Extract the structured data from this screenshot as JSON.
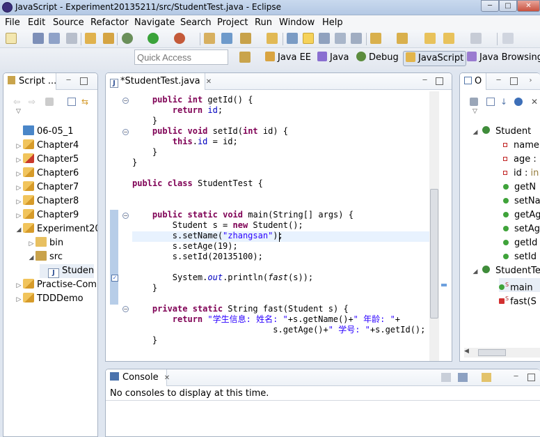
{
  "window": {
    "title": "JavaScript - Experiment20135211/src/StudentTest.java - Eclipse",
    "minimize": "─",
    "maximize": "□",
    "close": "✕"
  },
  "menu": [
    "File",
    "Edit",
    "Source",
    "Refactor",
    "Navigate",
    "Search",
    "Project",
    "Run",
    "Window",
    "Help"
  ],
  "quick_access": {
    "placeholder": "Quick Access"
  },
  "perspectives": [
    {
      "label": "Java EE",
      "icon": "java-ee-icon"
    },
    {
      "label": "Java",
      "icon": "java-icon"
    },
    {
      "label": "Debug",
      "icon": "debug-icon"
    },
    {
      "label": "JavaScript",
      "icon": "javascript-icon",
      "active": true
    },
    {
      "label": "Java Browsing",
      "icon": "java-browsing-icon"
    }
  ],
  "explorer": {
    "tab": "Script ...",
    "items": [
      {
        "label": "06-05_1"
      },
      {
        "label": "Chapter4"
      },
      {
        "label": "Chapter5"
      },
      {
        "label": "Chapter6"
      },
      {
        "label": "Chapter7"
      },
      {
        "label": "Chapter8"
      },
      {
        "label": "Chapter9"
      },
      {
        "label": "Experiment20"
      },
      {
        "label": "bin"
      },
      {
        "label": "src"
      },
      {
        "label": "Studen"
      },
      {
        "label": "Practise-Com"
      },
      {
        "label": "TDDDemo"
      }
    ]
  },
  "editor": {
    "tab": "*StudentTest.java",
    "lines": [
      [
        {
          "t": "    "
        },
        {
          "t": "public",
          "c": "kw"
        },
        {
          "t": " "
        },
        {
          "t": "int",
          "c": "kw"
        },
        {
          "t": " getId() {"
        }
      ],
      [
        {
          "t": "        "
        },
        {
          "t": "return",
          "c": "kw"
        },
        {
          "t": " "
        },
        {
          "t": "id",
          "c": "fld"
        },
        {
          "t": ";"
        }
      ],
      [
        {
          "t": "    }"
        }
      ],
      [
        {
          "t": "    "
        },
        {
          "t": "public",
          "c": "kw"
        },
        {
          "t": " "
        },
        {
          "t": "void",
          "c": "kw"
        },
        {
          "t": " setId("
        },
        {
          "t": "int",
          "c": "kw"
        },
        {
          "t": " id) {"
        }
      ],
      [
        {
          "t": "        "
        },
        {
          "t": "this",
          "c": "kw"
        },
        {
          "t": "."
        },
        {
          "t": "id",
          "c": "fld"
        },
        {
          "t": " = id;"
        }
      ],
      [
        {
          "t": "    }"
        }
      ],
      [
        {
          "t": "}"
        }
      ],
      [
        {
          "t": ""
        }
      ],
      [
        {
          "t": "public",
          "c": "kw"
        },
        {
          "t": " "
        },
        {
          "t": "class",
          "c": "kw"
        },
        {
          "t": " StudentTest {"
        }
      ],
      [
        {
          "t": ""
        }
      ],
      [
        {
          "t": ""
        }
      ],
      [
        {
          "t": "    "
        },
        {
          "t": "public",
          "c": "kw"
        },
        {
          "t": " "
        },
        {
          "t": "static",
          "c": "kw"
        },
        {
          "t": " "
        },
        {
          "t": "void",
          "c": "kw"
        },
        {
          "t": " main(String[] args) {"
        }
      ],
      [
        {
          "t": "        Student s = "
        },
        {
          "t": "new",
          "c": "kw"
        },
        {
          "t": " Student();"
        }
      ],
      [
        {
          "t": "        s.setName("
        },
        {
          "t": "\"zhangsan\"",
          "c": "str"
        },
        {
          "t": ");"
        }
      ],
      [
        {
          "t": "        s.setAge(19);"
        }
      ],
      [
        {
          "t": "        s.setId(20135100);"
        }
      ],
      [
        {
          "t": ""
        }
      ],
      [
        {
          "t": "        System."
        },
        {
          "t": "out",
          "c": "fld it"
        },
        {
          "t": ".println("
        },
        {
          "t": "fast",
          "c": "it"
        },
        {
          "t": "(s));"
        }
      ],
      [
        {
          "t": "    }"
        }
      ],
      [
        {
          "t": ""
        }
      ],
      [
        {
          "t": "    "
        },
        {
          "t": "private",
          "c": "kw"
        },
        {
          "t": " "
        },
        {
          "t": "static",
          "c": "kw"
        },
        {
          "t": " String fast(Student s) {"
        }
      ],
      [
        {
          "t": "        "
        },
        {
          "t": "return",
          "c": "kw"
        },
        {
          "t": " "
        },
        {
          "t": "\"学生信息: 姓名: \"",
          "c": "str"
        },
        {
          "t": "+s.getName()+"
        },
        {
          "t": "\" 年龄: \"",
          "c": "str"
        },
        {
          "t": "+"
        }
      ],
      [
        {
          "t": "                            s.getAge()+"
        },
        {
          "t": "\" 学号: \"",
          "c": "str"
        },
        {
          "t": "+s.getId();"
        }
      ],
      [
        {
          "t": "    }"
        }
      ]
    ]
  },
  "outline": {
    "tab": "O",
    "items": [
      {
        "label": "Student",
        "kind": "class"
      },
      {
        "label": "name",
        "kind": "field"
      },
      {
        "label": "age :",
        "kind": "field"
      },
      {
        "label": "id : ",
        "suffix": "in",
        "kind": "field"
      },
      {
        "label": "getN",
        "kind": "method"
      },
      {
        "label": "setNa",
        "kind": "method"
      },
      {
        "label": "getAg",
        "kind": "method"
      },
      {
        "label": "setAg",
        "kind": "method"
      },
      {
        "label": "getId",
        "kind": "method"
      },
      {
        "label": "setId",
        "kind": "method"
      },
      {
        "label": "StudentTe",
        "kind": "class"
      },
      {
        "label": "main",
        "sup": "S",
        "kind": "method"
      },
      {
        "label": "fast(S",
        "sup": "S",
        "kind": "private-method"
      }
    ]
  },
  "console": {
    "tab": "Console",
    "message": "No consoles to display at this time."
  },
  "colors": {
    "keyword": "#7f0055",
    "field": "#0000c0",
    "string": "#2a00ff"
  }
}
